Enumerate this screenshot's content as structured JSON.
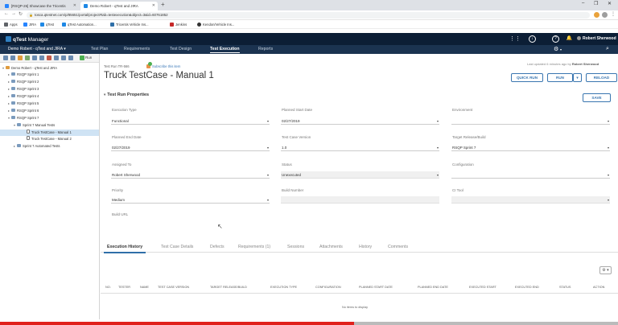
{
  "browser": {
    "tabs": [
      {
        "title": "[RSQP-26] Showcase the Tricentis",
        "favicon_color": "#2684ff"
      },
      {
        "title": "Demo Robert - qTest and JIRA",
        "favicon_color": "#1e88e5"
      }
    ],
    "new_tab": "+",
    "window_controls": [
      "–",
      "❐",
      "✕"
    ],
    "url": "tosca.qtestnet.com/p/85651/portal/project#tab=testexecution&object=3&id=60761852",
    "bookmarks": [
      {
        "label": "Apps",
        "color": "#5f6368"
      },
      {
        "label": "JIRA",
        "color": "#2684ff"
      },
      {
        "label": "qTest",
        "color": "#1e88e5"
      },
      {
        "label": "qTest Automation...",
        "color": "#1e88e5"
      },
      {
        "label": "Tricentis Vehicle Ins...",
        "color": "#2f6fa8"
      },
      {
        "label": "Jenkins",
        "color": "#c62828"
      },
      {
        "label": "Kendon/Vehicle Ins...",
        "color": "#333333"
      }
    ]
  },
  "app": {
    "logo_brand": "qTest",
    "logo_product": "Manager",
    "user_name": "Robert Sherwood",
    "project": "Demo Robert - qTest and JIRA ▾",
    "nav": [
      "Test Plan",
      "Requirements",
      "Test Design",
      "Test Execution",
      "Reports"
    ],
    "active_nav": "Test Execution",
    "header_icons": [
      "grid-icon",
      "download-icon",
      "help-icon",
      "notification-icon"
    ],
    "nav_right_icons": [
      "gear-icon",
      "search-icon"
    ]
  },
  "tree": {
    "toolbar_label": "Run",
    "nodes": [
      {
        "label": "Demo Robert - qTest and JIRA",
        "exp": "▾"
      },
      {
        "label": "RSQP Sprint 1",
        "exp": "▸"
      },
      {
        "label": "RSQP Sprint 2",
        "exp": "▸"
      },
      {
        "label": "RSQP Sprint 3",
        "exp": "▸"
      },
      {
        "label": "RSQP Sprint 4",
        "exp": "▸"
      },
      {
        "label": "RSQP Sprint 5",
        "exp": "▸"
      },
      {
        "label": "RSQP Sprint 6",
        "exp": "▸"
      },
      {
        "label": "RSQP Sprint 7",
        "exp": "▾"
      },
      {
        "label": "Sprint 7 Manual Tests",
        "exp": "▾"
      },
      {
        "label": "Truck TestCase - Manual 1",
        "exp": ""
      },
      {
        "label": "Truck TestCase - Manual 2",
        "exp": ""
      },
      {
        "label": "Sprint 7 Automated Tests",
        "exp": "▸"
      }
    ]
  },
  "testrun": {
    "id": "Test Run TR-566",
    "subscribe": "Subscribe this item",
    "last_updated_prefix": "Last updated 6 minutes ago by",
    "last_updated_user": "Robert Sherwood",
    "title": "Truck TestCase - Manual 1",
    "buttons": {
      "quick_run": "QUICK RUN",
      "run": "RUN",
      "run_caret": "▾",
      "reload": "RELOAD",
      "save": "SAVE"
    },
    "section_title": "Test Run Properties",
    "section_caret": "▾",
    "fields": {
      "execution_type": {
        "label": "Execution Type",
        "value": "Functional"
      },
      "planned_start": {
        "label": "Planned Start Date",
        "value": "02/27/2019"
      },
      "environment": {
        "label": "Environment",
        "value": ""
      },
      "planned_end": {
        "label": "Planned End Date",
        "value": "02/27/2019"
      },
      "test_case_version": {
        "label": "Test Case Version",
        "value": "1.0"
      },
      "target_release": {
        "label": "Target Release/Build",
        "value": "RSQP Sprint 7"
      },
      "assigned_to": {
        "label": "Assigned To",
        "value": "Robert Sherwood"
      },
      "status": {
        "label": "Status",
        "value": "Unexecuted"
      },
      "configuration": {
        "label": "Configuration",
        "value": ""
      },
      "priority": {
        "label": "Priority",
        "value": "Medium"
      },
      "build_number": {
        "label": "Build Number",
        "value": ""
      },
      "ci_tool": {
        "label": "CI Tool",
        "value": ""
      },
      "build_url": {
        "label": "Build URL",
        "value": ""
      }
    }
  },
  "bottom": {
    "tabs": [
      "Execution History",
      "Test Case Details",
      "Defects",
      "Requirements (1)",
      "Sessions",
      "Attachments",
      "History",
      "Comments"
    ],
    "active_tab": "Execution History",
    "columns": [
      "NO.",
      "TESTER",
      "NAME",
      "TEST CASE VERSION",
      "TARGET RELEASE/BUILD",
      "EXECUTION TYPE",
      "CONFIGURATION",
      "PLANNED START DATE",
      "PLANNED END DATE",
      "EXECUTED START",
      "EXECUTED END",
      "STATUS",
      "ACTION"
    ],
    "empty_message": "No items to display",
    "gear": "⚙ ▾"
  },
  "video": {
    "progress": 0.573
  }
}
